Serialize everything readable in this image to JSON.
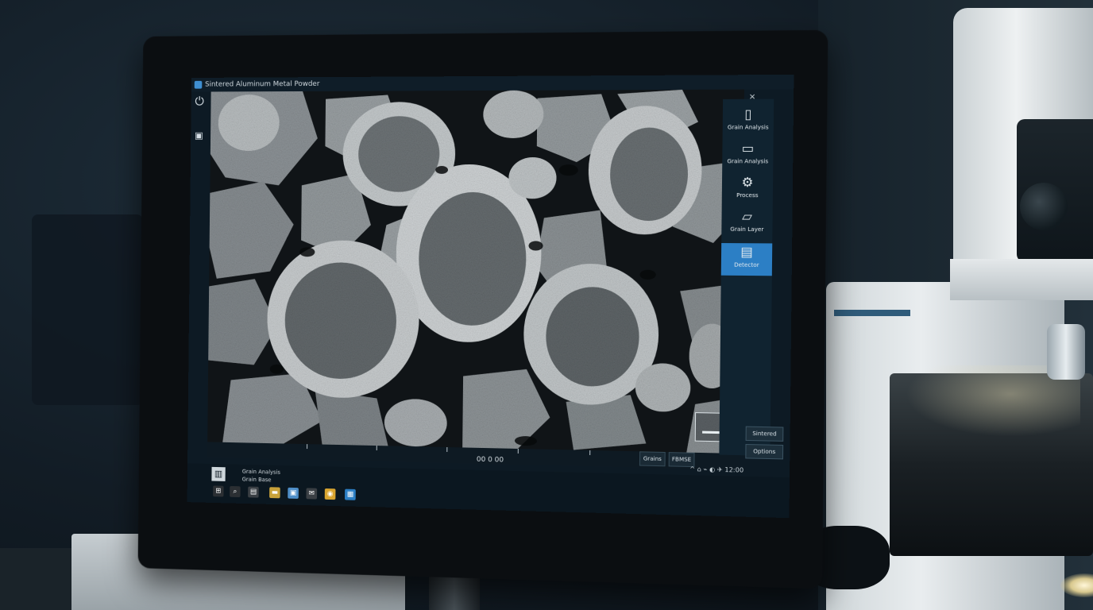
{
  "window": {
    "title": "Sintered Aluminum Metal Powder",
    "controls": "? □ ×"
  },
  "left_rail": {
    "icons": [
      "power-icon",
      "save-icon"
    ]
  },
  "tool_panel": {
    "items": [
      {
        "icon": "document-icon",
        "label": "Grain Analysis"
      },
      {
        "icon": "folder-icon",
        "label": "Grain Analysis"
      },
      {
        "icon": "gear-icon",
        "label": "Process"
      },
      {
        "icon": "folder-open-icon",
        "label": "Grain Layer"
      },
      {
        "icon": "window-icon",
        "label": "Detector"
      }
    ],
    "active_index": 4,
    "buttons": [
      "Sintered",
      "Options"
    ]
  },
  "bottom_bar": {
    "readout": "00 0 00",
    "buttons": [
      "Grains",
      "FBMSE"
    ],
    "tray": "^ ⌂ ⌁ ◐ ✈ 12:00"
  },
  "taskbar": {
    "footer_line1": "Grain Analysis",
    "footer_line2": "Grain Base",
    "apps": [
      {
        "icon": "start-icon",
        "glyph": "⊞",
        "color": "#2b2f33"
      },
      {
        "icon": "search-icon",
        "glyph": "⌕",
        "color": "#2b2f33"
      },
      {
        "icon": "files-icon",
        "glyph": "▤",
        "color": "#3a3f44"
      },
      {
        "icon": "folder-icon",
        "glyph": "▬",
        "color": "#c9a23a"
      },
      {
        "icon": "store-icon",
        "glyph": "▣",
        "color": "#4f8fc9"
      },
      {
        "icon": "mail-icon",
        "glyph": "✉",
        "color": "#3a3f44"
      },
      {
        "icon": "browser-icon",
        "glyph": "◉",
        "color": "#d9a530"
      },
      {
        "icon": "app-icon",
        "glyph": "▦",
        "color": "#2c7fc5"
      }
    ]
  }
}
